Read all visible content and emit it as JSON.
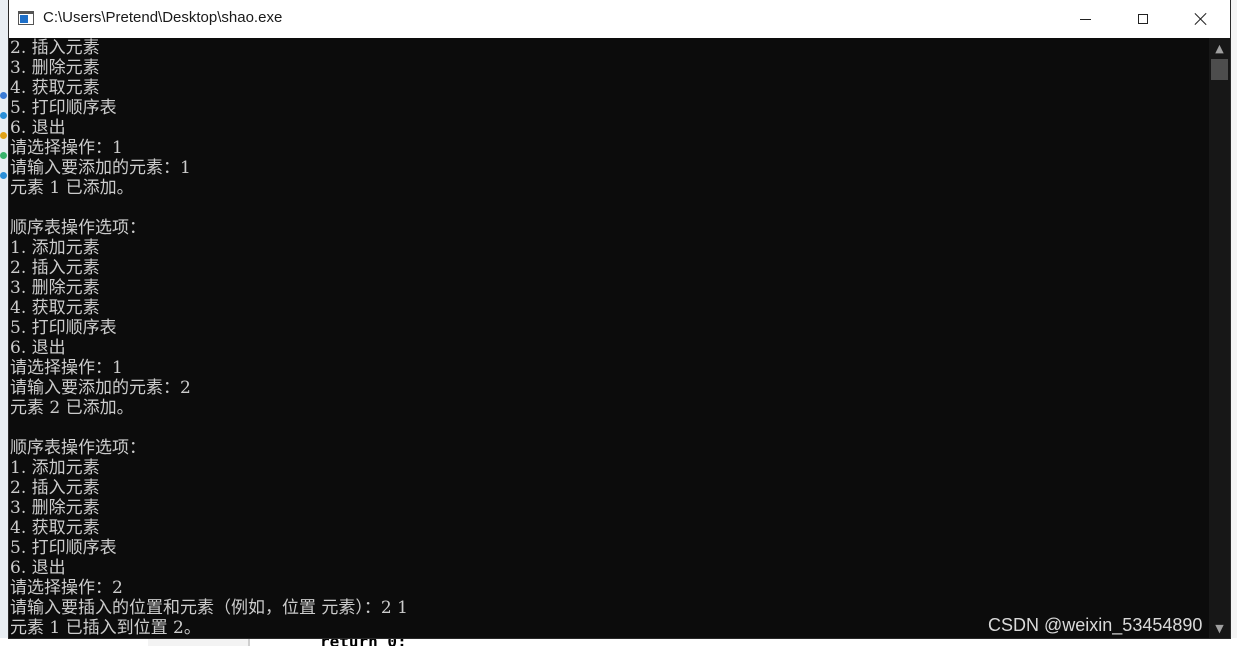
{
  "window": {
    "title": "C:\\Users\\Pretend\\Desktop\\shao.exe",
    "minimize_symbol": "—",
    "maximize_symbol": "☐",
    "close_symbol": "✕"
  },
  "console": {
    "lines": [
      "2. 插入元素",
      "3. 删除元素",
      "4. 获取元素",
      "5. 打印顺序表",
      "6. 退出",
      "请选择操作：1",
      "请输入要添加的元素：1",
      "元素 1 已添加。",
      "",
      "顺序表操作选项：",
      "1. 添加元素",
      "2. 插入元素",
      "3. 删除元素",
      "4. 获取元素",
      "5. 打印顺序表",
      "6. 退出",
      "请选择操作：1",
      "请输入要添加的元素：2",
      "元素 2 已添加。",
      "",
      "顺序表操作选项：",
      "1. 添加元素",
      "2. 插入元素",
      "3. 删除元素",
      "4. 获取元素",
      "5. 打印顺序表",
      "6. 退出",
      "请选择操作：2",
      "请输入要插入的位置和元素（例如，位置 元素）：2 1",
      "元素 1 已插入到位置 2。"
    ]
  },
  "watermark": "CSDN @weixin_53454890",
  "background": {
    "code_snippet": "return 0;"
  },
  "colors": {
    "console_bg": "#0c0c0c",
    "console_text": "#cccccc",
    "titlebar_bg": "#ffffff"
  }
}
